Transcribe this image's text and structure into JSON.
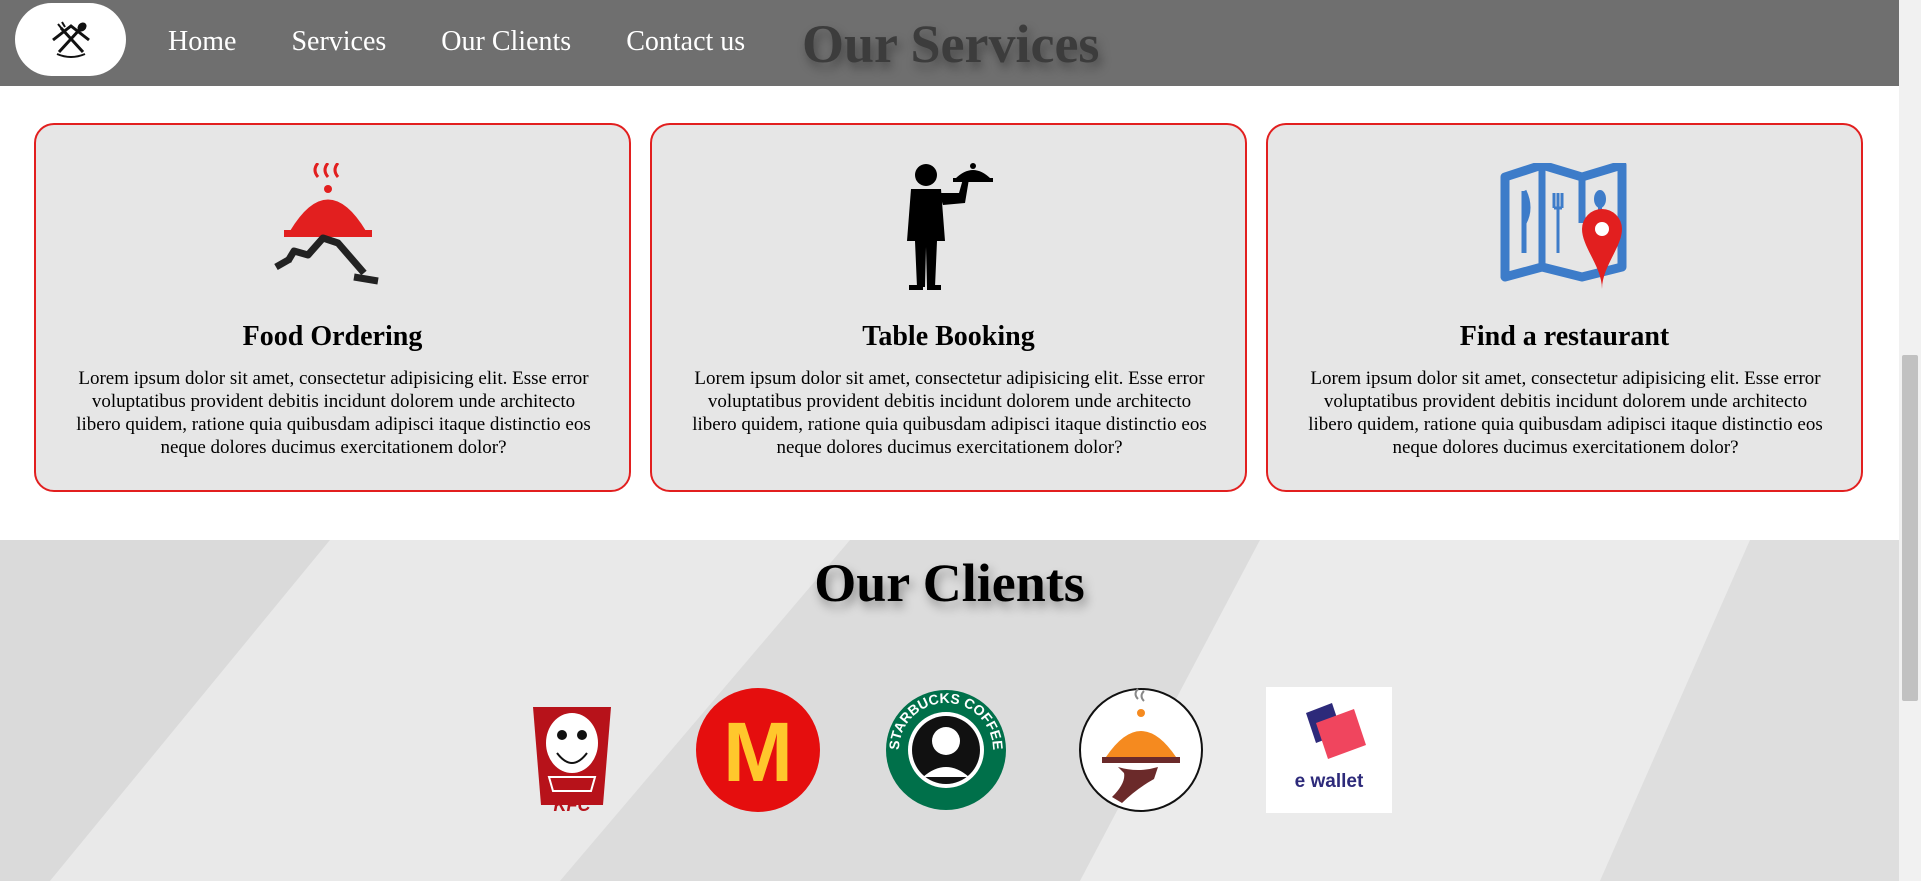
{
  "nav": {
    "logo_icon": "fork-spoon-house-icon",
    "links": [
      "Home",
      "Services",
      "Our Clients",
      "Contact us"
    ]
  },
  "services": {
    "heading": "Our Services",
    "cards": [
      {
        "icon": "food-delivery-icon",
        "title": "Food Ordering",
        "text": "Lorem ipsum dolor sit amet, consectetur adipisicing elit. Esse error voluptatibus provident debitis incidunt dolorem unde architecto libero quidem, ratione quia quibusdam adipisci itaque distinctio eos neque dolores ducimus exercitationem dolor?"
      },
      {
        "icon": "waiter-icon",
        "title": "Table Booking",
        "text": "Lorem ipsum dolor sit amet, consectetur adipisicing elit. Esse error voluptatibus provident debitis incidunt dolorem unde architecto libero quidem, ratione quia quibusdam adipisci itaque distinctio eos neque dolores ducimus exercitationem dolor?"
      },
      {
        "icon": "restaurant-map-icon",
        "title": "Find a restaurant",
        "text": "Lorem ipsum dolor sit amet, consectetur adipisicing elit. Esse error voluptatibus provident debitis incidunt dolorem unde architecto libero quidem, ratione quia quibusdam adipisci itaque distinctio eos neque dolores ducimus exercitationem dolor?"
      }
    ]
  },
  "clients": {
    "heading": "Our Clients",
    "logos": [
      {
        "name": "kfc-logo",
        "text": "KFC"
      },
      {
        "name": "mcdonalds-logo",
        "text": "M"
      },
      {
        "name": "starbucks-logo",
        "text": "STARBUCKS COFFEE"
      },
      {
        "name": "food-delivery-logo",
        "text": ""
      },
      {
        "name": "ewallet-logo",
        "text": "e wallet"
      }
    ]
  },
  "colors": {
    "navbar": "#6f6f6f",
    "card_border": "#e21f1f",
    "card_bg": "#e6e6e6",
    "accent_red": "#e21f1f",
    "map_blue": "#3d7cc9"
  }
}
